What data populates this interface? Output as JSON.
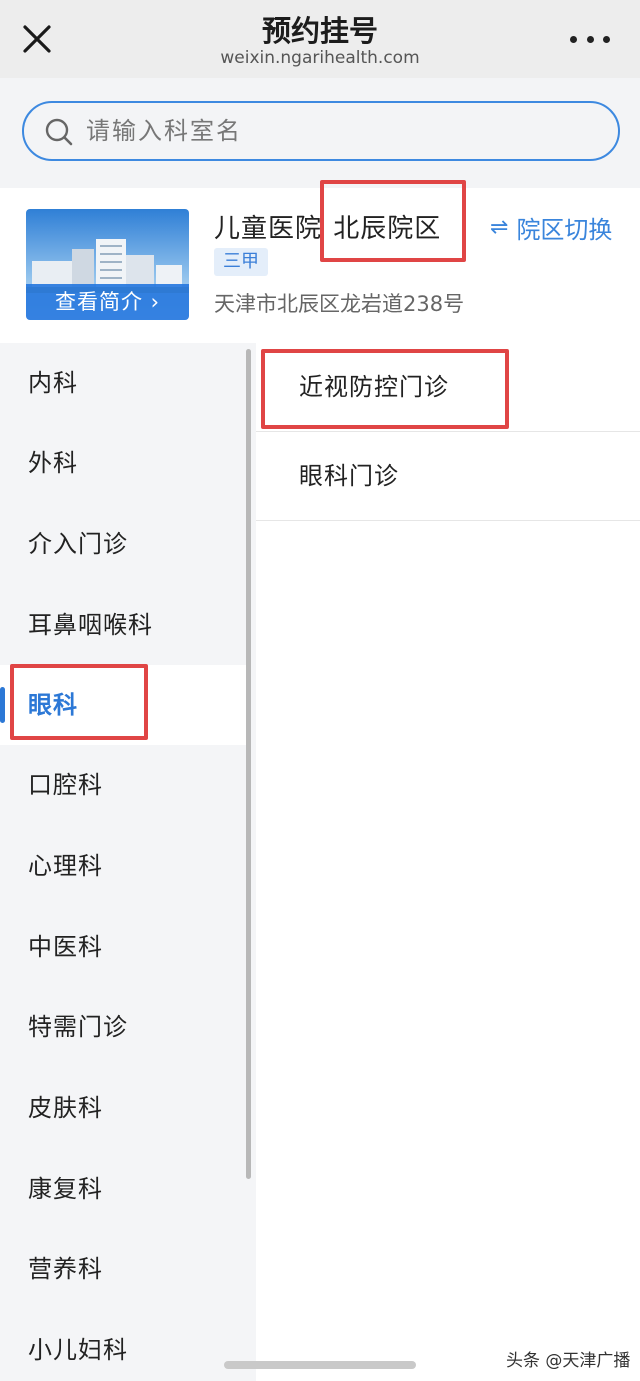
{
  "header": {
    "title": "预约挂号",
    "url": "weixin.ngarihealth.com"
  },
  "search": {
    "placeholder": "请输入科室名"
  },
  "hospital": {
    "view_intro": "查看简介 ›",
    "name": "儿童医院",
    "branch": "北辰院区",
    "grade_badge": "三甲",
    "address": "天津市北辰区龙岩道238号",
    "switch_icon": "⇌",
    "switch_label": "院区切换"
  },
  "departments": [
    {
      "label": "内科"
    },
    {
      "label": "外科"
    },
    {
      "label": "介入门诊"
    },
    {
      "label": "耳鼻咽喉科"
    },
    {
      "label": "眼科"
    },
    {
      "label": "口腔科"
    },
    {
      "label": "心理科"
    },
    {
      "label": "中医科"
    },
    {
      "label": "特需门诊"
    },
    {
      "label": "皮肤科"
    },
    {
      "label": "康复科"
    },
    {
      "label": "营养科"
    },
    {
      "label": "小儿妇科"
    }
  ],
  "selected_department": "眼科",
  "clinics": [
    {
      "label": "近视防控门诊"
    },
    {
      "label": "眼科门诊"
    }
  ],
  "watermark": "头条 @天津广播",
  "colors": {
    "accent": "#2c78d6",
    "highlight_box": "#e04545",
    "sidebar_bg": "#f4f5f7"
  },
  "icons": [
    "close-icon",
    "more-icon",
    "search-icon",
    "swap-icon"
  ]
}
